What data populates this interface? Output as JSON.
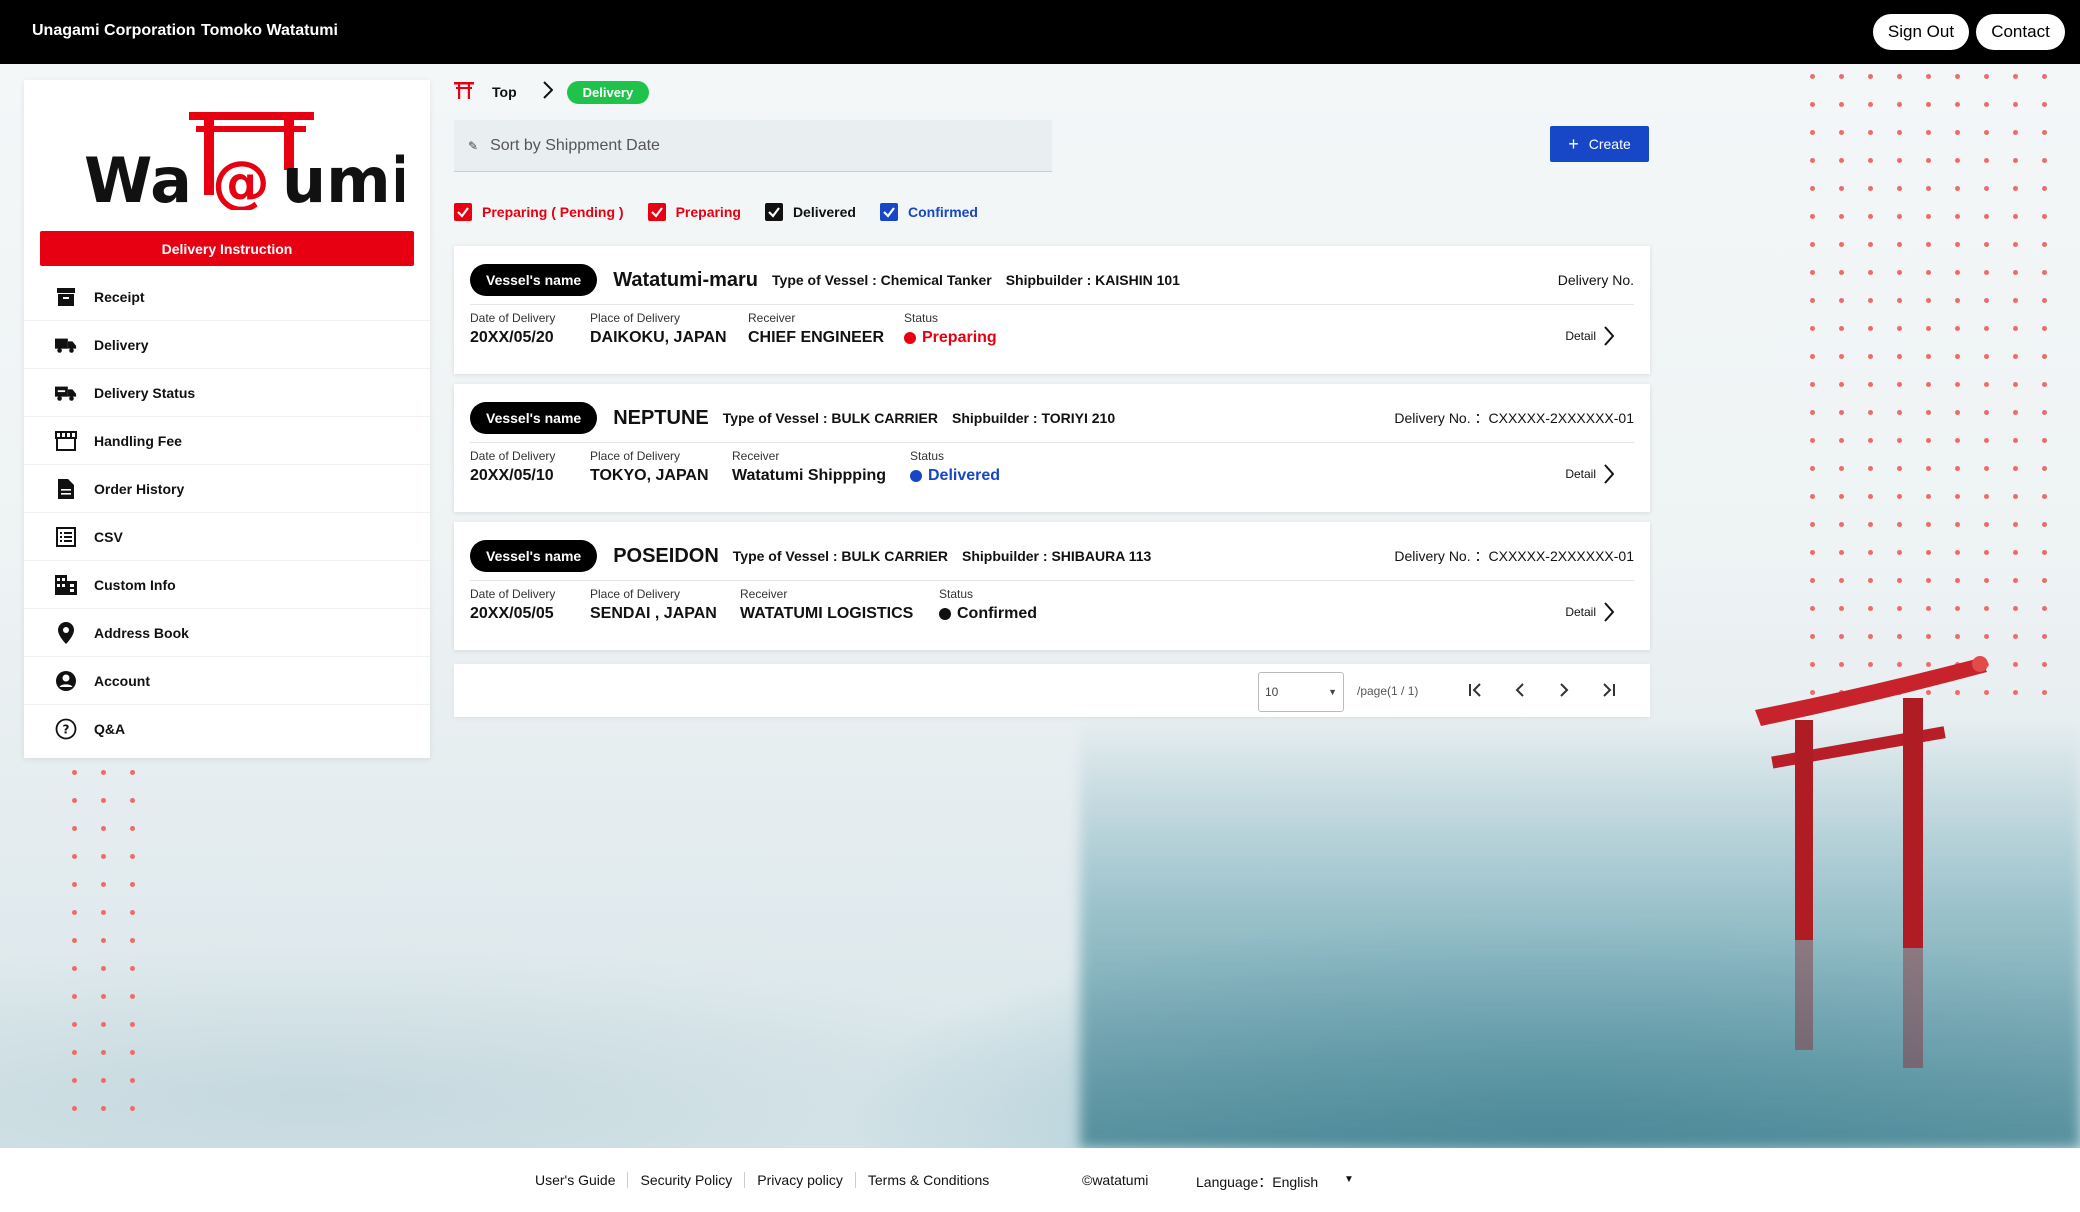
{
  "header": {
    "company": "Unagami Corporation",
    "user": "Tomoko Watatumi",
    "sign_out": "Sign Out",
    "contact": "Contact"
  },
  "sidebar": {
    "logo_text": "Wat@tumi",
    "primary_button": "Delivery Instruction",
    "items": [
      {
        "label": "Receipt",
        "icon": "archive-box-icon"
      },
      {
        "label": "Delivery",
        "icon": "truck-icon"
      },
      {
        "label": "Delivery Status",
        "icon": "truck-status-icon"
      },
      {
        "label": "Handling Fee",
        "icon": "store-icon"
      },
      {
        "label": "Order History",
        "icon": "document-icon"
      },
      {
        "label": "CSV",
        "icon": "list-sheet-icon"
      },
      {
        "label": "Custom Info",
        "icon": "building-icon"
      },
      {
        "label": "Address Book",
        "icon": "map-pin-icon"
      },
      {
        "label": "Account",
        "icon": "user-circle-icon"
      },
      {
        "label": "Q&A",
        "icon": "help-circle-icon"
      }
    ]
  },
  "breadcrumb": {
    "home_icon": "torii-icon",
    "top": "Top",
    "current": "Delivery"
  },
  "toolbar": {
    "sort_placeholder": "Sort by Shippment Date",
    "create_label": "Create"
  },
  "filters": [
    {
      "label": "Preparing ( Pending )",
      "checked": true,
      "color": "#e60012"
    },
    {
      "label": "Preparing",
      "checked": true,
      "color": "#e60012"
    },
    {
      "label": "Delivered",
      "checked": true,
      "color": "#111111"
    },
    {
      "label": "Confirmed",
      "checked": true,
      "color": "#1746c7"
    }
  ],
  "labels": {
    "vessel_tag": "Vessel's name",
    "date_key": "Date of Delivery",
    "place_key": "Place of Delivery",
    "receiver_key": "Receiver",
    "status_key": "Status",
    "detail": "Detail"
  },
  "deliveries": [
    {
      "vessel": "Watatumi-maru",
      "type": "Type of Vessel : Chemical Tanker",
      "builder": "Shipbuilder : KAISHIN 101",
      "delivery_no": "Delivery No.",
      "date": "20XX/05/20",
      "place": "DAIKOKU, JAPAN",
      "receiver": "CHIEF ENGINEER",
      "status": "Preparing",
      "status_color": "#e60012"
    },
    {
      "vessel": "NEPTUNE",
      "type": "Type of Vessel : BULK CARRIER",
      "builder": "Shipbuilder : TORIYI 210",
      "delivery_no": "Delivery No. ：CXXXXX-2XXXXXX-01",
      "date": "20XX/05/10",
      "place": "TOKYO, JAPAN",
      "receiver": "Watatumi Shippping",
      "status": "Delivered",
      "status_color": "#1746c7"
    },
    {
      "vessel": "POSEIDON",
      "type": "Type of Vessel : BULK CARRIER",
      "builder": "Shipbuilder : SHIBAURA 113",
      "delivery_no": "Delivery No. ：CXXXXX-2XXXXXX-01",
      "date": "20XX/05/05",
      "place": "SENDAI , JAPAN",
      "receiver": "WATATUMI LOGISTICS",
      "status": "Confirmed",
      "status_color": "#111111"
    }
  ],
  "pagination": {
    "per_page": "10",
    "info": "/page(1 / 1)"
  },
  "footer": {
    "links": [
      "User's Guide",
      "Security Policy",
      "Privacy policy",
      "Terms & Conditions"
    ],
    "copyright": "©watatumi",
    "language": "Language：English"
  },
  "colors": {
    "brand_red": "#e60012",
    "accent_blue": "#1746c7",
    "breadcrumb_green": "#1fc24b"
  }
}
